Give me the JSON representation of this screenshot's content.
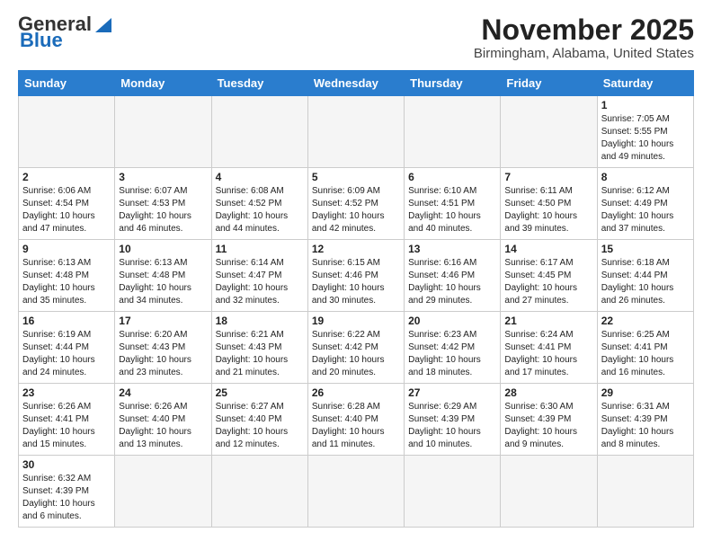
{
  "logo": {
    "text_general": "General",
    "text_blue": "Blue"
  },
  "title": "November 2025",
  "subtitle": "Birmingham, Alabama, United States",
  "days_header": [
    "Sunday",
    "Monday",
    "Tuesday",
    "Wednesday",
    "Thursday",
    "Friday",
    "Saturday"
  ],
  "weeks": [
    [
      {
        "num": "",
        "info": "",
        "empty": true
      },
      {
        "num": "",
        "info": "",
        "empty": true
      },
      {
        "num": "",
        "info": "",
        "empty": true
      },
      {
        "num": "",
        "info": "",
        "empty": true
      },
      {
        "num": "",
        "info": "",
        "empty": true
      },
      {
        "num": "",
        "info": "",
        "empty": true
      },
      {
        "num": "1",
        "info": "Sunrise: 7:05 AM\nSunset: 5:55 PM\nDaylight: 10 hours and 49 minutes."
      }
    ],
    [
      {
        "num": "2",
        "info": "Sunrise: 6:06 AM\nSunset: 4:54 PM\nDaylight: 10 hours and 47 minutes."
      },
      {
        "num": "3",
        "info": "Sunrise: 6:07 AM\nSunset: 4:53 PM\nDaylight: 10 hours and 46 minutes."
      },
      {
        "num": "4",
        "info": "Sunrise: 6:08 AM\nSunset: 4:52 PM\nDaylight: 10 hours and 44 minutes."
      },
      {
        "num": "5",
        "info": "Sunrise: 6:09 AM\nSunset: 4:52 PM\nDaylight: 10 hours and 42 minutes."
      },
      {
        "num": "6",
        "info": "Sunrise: 6:10 AM\nSunset: 4:51 PM\nDaylight: 10 hours and 40 minutes."
      },
      {
        "num": "7",
        "info": "Sunrise: 6:11 AM\nSunset: 4:50 PM\nDaylight: 10 hours and 39 minutes."
      },
      {
        "num": "8",
        "info": "Sunrise: 6:12 AM\nSunset: 4:49 PM\nDaylight: 10 hours and 37 minutes."
      }
    ],
    [
      {
        "num": "9",
        "info": "Sunrise: 6:13 AM\nSunset: 4:48 PM\nDaylight: 10 hours and 35 minutes."
      },
      {
        "num": "10",
        "info": "Sunrise: 6:13 AM\nSunset: 4:48 PM\nDaylight: 10 hours and 34 minutes."
      },
      {
        "num": "11",
        "info": "Sunrise: 6:14 AM\nSunset: 4:47 PM\nDaylight: 10 hours and 32 minutes."
      },
      {
        "num": "12",
        "info": "Sunrise: 6:15 AM\nSunset: 4:46 PM\nDaylight: 10 hours and 30 minutes."
      },
      {
        "num": "13",
        "info": "Sunrise: 6:16 AM\nSunset: 4:46 PM\nDaylight: 10 hours and 29 minutes."
      },
      {
        "num": "14",
        "info": "Sunrise: 6:17 AM\nSunset: 4:45 PM\nDaylight: 10 hours and 27 minutes."
      },
      {
        "num": "15",
        "info": "Sunrise: 6:18 AM\nSunset: 4:44 PM\nDaylight: 10 hours and 26 minutes."
      }
    ],
    [
      {
        "num": "16",
        "info": "Sunrise: 6:19 AM\nSunset: 4:44 PM\nDaylight: 10 hours and 24 minutes."
      },
      {
        "num": "17",
        "info": "Sunrise: 6:20 AM\nSunset: 4:43 PM\nDaylight: 10 hours and 23 minutes."
      },
      {
        "num": "18",
        "info": "Sunrise: 6:21 AM\nSunset: 4:43 PM\nDaylight: 10 hours and 21 minutes."
      },
      {
        "num": "19",
        "info": "Sunrise: 6:22 AM\nSunset: 4:42 PM\nDaylight: 10 hours and 20 minutes."
      },
      {
        "num": "20",
        "info": "Sunrise: 6:23 AM\nSunset: 4:42 PM\nDaylight: 10 hours and 18 minutes."
      },
      {
        "num": "21",
        "info": "Sunrise: 6:24 AM\nSunset: 4:41 PM\nDaylight: 10 hours and 17 minutes."
      },
      {
        "num": "22",
        "info": "Sunrise: 6:25 AM\nSunset: 4:41 PM\nDaylight: 10 hours and 16 minutes."
      }
    ],
    [
      {
        "num": "23",
        "info": "Sunrise: 6:26 AM\nSunset: 4:41 PM\nDaylight: 10 hours and 15 minutes."
      },
      {
        "num": "24",
        "info": "Sunrise: 6:26 AM\nSunset: 4:40 PM\nDaylight: 10 hours and 13 minutes."
      },
      {
        "num": "25",
        "info": "Sunrise: 6:27 AM\nSunset: 4:40 PM\nDaylight: 10 hours and 12 minutes."
      },
      {
        "num": "26",
        "info": "Sunrise: 6:28 AM\nSunset: 4:40 PM\nDaylight: 10 hours and 11 minutes."
      },
      {
        "num": "27",
        "info": "Sunrise: 6:29 AM\nSunset: 4:39 PM\nDaylight: 10 hours and 10 minutes."
      },
      {
        "num": "28",
        "info": "Sunrise: 6:30 AM\nSunset: 4:39 PM\nDaylight: 10 hours and 9 minutes."
      },
      {
        "num": "29",
        "info": "Sunrise: 6:31 AM\nSunset: 4:39 PM\nDaylight: 10 hours and 8 minutes."
      }
    ],
    [
      {
        "num": "30",
        "info": "Sunrise: 6:32 AM\nSunset: 4:39 PM\nDaylight: 10 hours and 6 minutes."
      },
      {
        "num": "",
        "info": "",
        "empty": true
      },
      {
        "num": "",
        "info": "",
        "empty": true
      },
      {
        "num": "",
        "info": "",
        "empty": true
      },
      {
        "num": "",
        "info": "",
        "empty": true
      },
      {
        "num": "",
        "info": "",
        "empty": true
      },
      {
        "num": "",
        "info": "",
        "empty": true
      }
    ]
  ]
}
